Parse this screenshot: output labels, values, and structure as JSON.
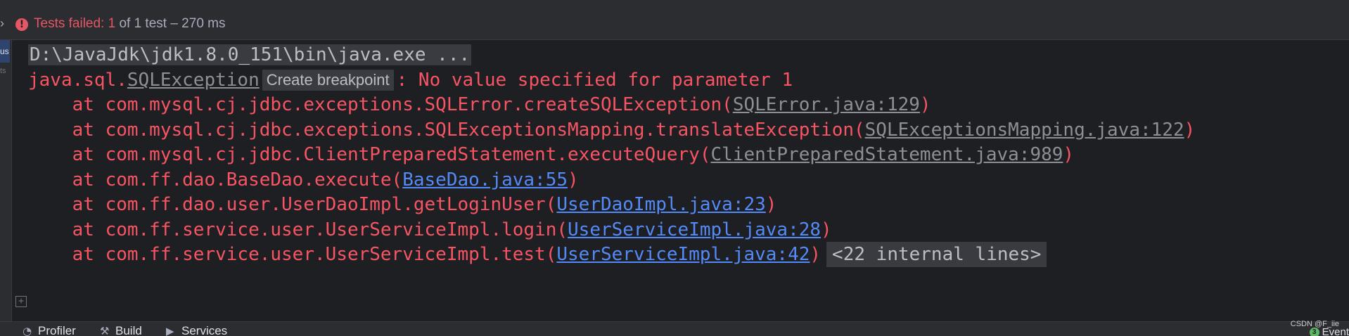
{
  "header": {
    "failed_label": "Tests failed: ",
    "failed_count": "1",
    "summary": " of 1 test – 270 ms"
  },
  "gutter": {
    "active_label": "us",
    "second_label": "ts"
  },
  "console": {
    "command": "D:\\JavaJdk\\jdk1.8.0_151\\bin\\java.exe ...",
    "exception_prefix": "java.sql.",
    "exception_class": "SQLException",
    "breakpoint_hint": "Create breakpoint",
    "exception_message": ": No value specified for parameter 1",
    "frames": [
      {
        "prefix": "    at com.mysql.cj.jdbc.exceptions.SQLError.createSQLException(",
        "link": "SQLError.java:129",
        "suffix": ")",
        "kind": "library"
      },
      {
        "prefix": "    at com.mysql.cj.jdbc.exceptions.SQLExceptionsMapping.translateException(",
        "link": "SQLExceptionsMapping.java:122",
        "suffix": ")",
        "kind": "library"
      },
      {
        "prefix": "    at com.mysql.cj.jdbc.ClientPreparedStatement.executeQuery(",
        "link": "ClientPreparedStatement.java:989",
        "suffix": ")",
        "kind": "library"
      },
      {
        "prefix": "    at com.ff.dao.BaseDao.execute(",
        "link": "BaseDao.java:55",
        "suffix": ")",
        "kind": "project"
      },
      {
        "prefix": "    at com.ff.dao.user.UserDaoImpl.getLoginUser(",
        "link": "UserDaoImpl.java:23",
        "suffix": ")",
        "kind": "project"
      },
      {
        "prefix": "    at com.ff.service.user.UserServiceImpl.login(",
        "link": "UserServiceImpl.java:28",
        "suffix": ")",
        "kind": "project"
      },
      {
        "prefix": "    at com.ff.service.user.UserServiceImpl.test(",
        "link": "UserServiceImpl.java:42",
        "suffix": ")",
        "kind": "project"
      }
    ],
    "internal_lines": "<22 internal lines>",
    "expand_glyph": "+"
  },
  "bottom_bar": {
    "profiler": "Profiler",
    "build": "Build",
    "services": "Services",
    "events": "Event",
    "events_count": "3"
  },
  "watermark": "CSDN @F_iie",
  "colors": {
    "error": "#f75464",
    "link": "#548af7",
    "library_link": "#8c8f96",
    "fail_badge": "#e55765"
  },
  "icons": {
    "header": "chevron-right-icon",
    "status": "test-failed-icon",
    "expand": "expand-plus-icon",
    "profiler": "profiler-icon",
    "build": "hammer-icon",
    "services": "services-icon"
  }
}
